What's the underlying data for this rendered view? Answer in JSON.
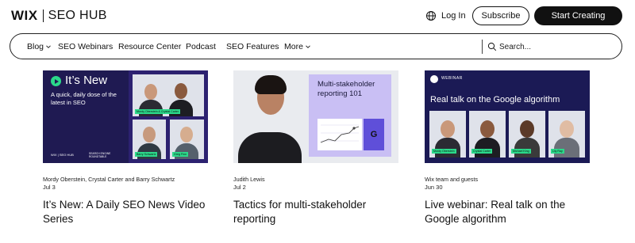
{
  "header": {
    "logo_wix": "WIX",
    "logo_hub": "SEO HUB",
    "login": "Log In",
    "subscribe": "Subscribe",
    "start": "Start Creating"
  },
  "nav": {
    "items": [
      {
        "label": "Blog",
        "has_chevron": true
      },
      {
        "label": "SEO Webinars",
        "has_chevron": false
      },
      {
        "label": "Resource Center",
        "has_chevron": false
      },
      {
        "label": "Podcast",
        "has_chevron": false
      },
      {
        "label": "SEO Features",
        "has_chevron": false
      },
      {
        "label": "More",
        "has_chevron": true
      }
    ],
    "search_placeholder": "Search..."
  },
  "cards": [
    {
      "thumb": {
        "title": "It’s New",
        "subtitle": "A quick, daily dose of the latest in SEO",
        "footer": "WIX | SEO HUB",
        "footer2": "SEARCH ENGINE ROUNDTABLE",
        "tags": [
          "Mordy Oberstein & Crystal Carter",
          "Barry Schwartz",
          "Greg Finn"
        ]
      },
      "author": "Mordy Oberstein, Crystal Carter and Barry Schwartz",
      "date": "Jul 3",
      "title": "It’s New: A Daily SEO News Video Series"
    },
    {
      "thumb": {
        "panel_title": "Multi-stakeholder reporting 101",
        "g_label": "G"
      },
      "author": "Judith Lewis",
      "date": "Jul 2",
      "title": "Tactics for multi-stakeholder reporting"
    },
    {
      "thumb": {
        "badge": "WEBINAR",
        "title": "Real talk on the Google algorithm",
        "tags": [
          "Mordy Oberstein",
          "Crystal Carter",
          "Michael King",
          "Lily Ray"
        ]
      },
      "author": "Wix team and guests",
      "date": "Jun 30",
      "title": "Live webinar: Real talk on the Google algorithm"
    }
  ],
  "colors": {
    "accent_green": "#2bd98a",
    "navy": "#1f1a52",
    "lavender": "#c9bff4",
    "button_dark": "#111111"
  }
}
